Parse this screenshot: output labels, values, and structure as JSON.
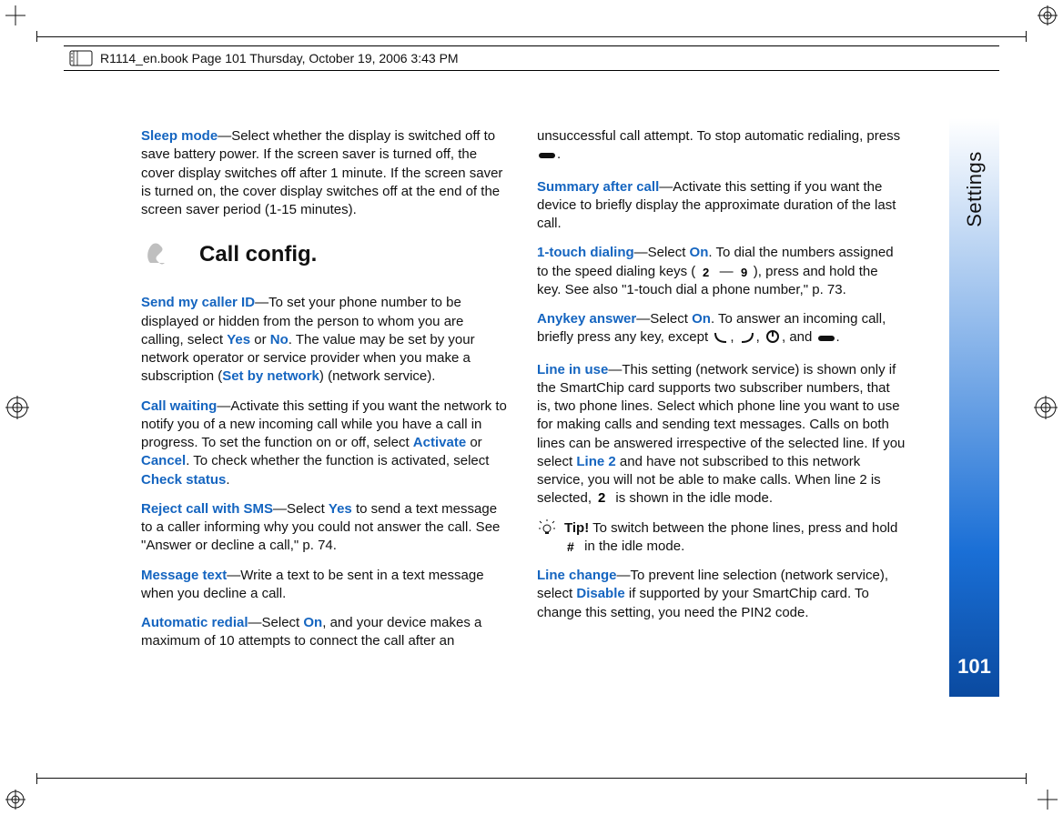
{
  "header": {
    "book_info": "R1114_en.book  Page 101  Thursday, October 19, 2006  3:43 PM"
  },
  "side_tab": {
    "label": "Settings",
    "page_number": "101"
  },
  "col1": {
    "p1_term": "Sleep mode",
    "p1_rest": "—Select whether the display is switched off to save battery power. If the screen saver is turned off, the cover display switches off after 1 minute. If the screen saver is turned on, the cover display switches off at the end of the screen saver period (1-15 minutes).",
    "section_title": "Call config.",
    "p2_term": "Send my caller ID",
    "p2_a": "—To set your phone number to be displayed or hidden from the person to whom you are calling, select ",
    "p2_yes": "Yes",
    "p2_or": " or ",
    "p2_no": "No",
    "p2_b": ". The value may be set by your network operator or service provider when you make a subscription (",
    "p2_set": "Set by network",
    "p2_c": ") (network service).",
    "p3_term": "Call waiting",
    "p3_a": "—Activate this setting if you want the network to notify you of a new incoming call while you have a call in progress. To set the function on or off, select ",
    "p3_act": "Activate",
    "p3_or": " or ",
    "p3_can": "Cancel",
    "p3_b": ". To check whether the function is activated, select ",
    "p3_chk": "Check status",
    "p3_c": ".",
    "p4_term": "Reject call with SMS",
    "p4_a": "—Select ",
    "p4_yes": "Yes",
    "p4_b": " to send a text message to a caller informing why you could not answer the call. See \"Answer or decline a call,\" p. 74.",
    "p5_term": "Message text",
    "p5_a": "—Write a text to be sent in a text message when you decline a call.",
    "p6_term": "Automatic redial",
    "p6_a": "—Select ",
    "p6_on": "On",
    "p6_b": ", and your device makes a maximum of 10 attempts to connect the call after an"
  },
  "col2": {
    "p1_a": "unsuccessful call attempt. To stop automatic redialing, press ",
    "p1_b": ".",
    "p2_term": "Summary after call",
    "p2_a": "—Activate this setting if you want the device to briefly display the approximate duration of the last call.",
    "p3_term": "1-touch dialing",
    "p3_a": "—Select ",
    "p3_on": "On",
    "p3_b": ". To dial the numbers assigned to the speed dialing keys (",
    "p3_dash": " — ",
    "p3_c": "), press and hold the key. See also \"1-touch dial a phone number,\" p. 73.",
    "p4_term": "Anykey answer",
    "p4_a": "—Select ",
    "p4_on": "On",
    "p4_b": ". To answer an incoming call, briefly press any key, except ",
    "p4_c": ", ",
    "p4_d": ", ",
    "p4_e": ", and ",
    "p4_f": ".",
    "p5_term": "Line in use",
    "p5_a": "—This setting (network service) is shown only if the SmartChip card supports two subscriber numbers, that is, two phone lines. Select which phone line you want to use for making calls and sending text messages. Calls on both lines can be answered irrespective of the selected line. If you select ",
    "p5_line2": "Line 2",
    "p5_b": " and have not subscribed to this network service, you will not be able to make calls. When line 2 is selected, ",
    "p5_c": " is shown in the idle mode.",
    "tip_label": "Tip!",
    "tip_a": " To switch between the phone lines, press and hold ",
    "tip_b": " in the idle mode.",
    "p6_term": "Line change",
    "p6_a": "—To prevent line selection (network service), select ",
    "p6_dis": "Disable",
    "p6_b": " if supported by your SmartChip card. To change this setting, you need the PIN2 code."
  }
}
